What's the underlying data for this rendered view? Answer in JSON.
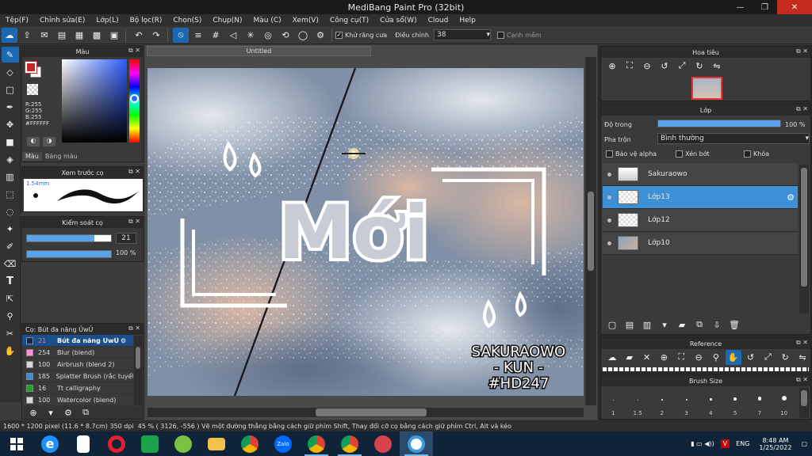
{
  "window": {
    "title": "MediBang Paint Pro (32bit)",
    "minimize_glyph": "—",
    "restore_glyph": "❐",
    "close_glyph": "✕"
  },
  "menu": [
    "Tệp(F)",
    "Chỉnh sửa(E)",
    "Lớp(L)",
    "Bộ lọc(R)",
    "Chọn(S)",
    "Chụp(N)",
    "Màu (C)",
    "Xem(V)",
    "Công cụ(T)",
    "Cửa sổ(W)",
    "Cloud",
    "Help"
  ],
  "toolbar": {
    "antialias_label": "Khử răng cưa",
    "antialias_checked": true,
    "adjust_label": "Điều chỉnh",
    "adjust_value": "38",
    "snap_label": "Cạnh mềm"
  },
  "color_panel": {
    "title": "Màu",
    "r": "R:255",
    "g": "G:255",
    "b": "B:255",
    "hex": "#FFFFFF",
    "tab_color": "Màu",
    "tab_palette": "Bảng màu",
    "fg_color": "#c62828",
    "bg_color": "#ffffff"
  },
  "brush_preview": {
    "title": "Xem trước cọ",
    "size": "1.54mm"
  },
  "brush_control": {
    "title": "Kiểm soát cọ",
    "size_value": "21",
    "opacity_value": "100 %",
    "size_fill": 0.8,
    "opacity_fill": 1.0
  },
  "brush_list": {
    "title": "Cọ: Bút đa năng ỦwỦ",
    "items": [
      {
        "size": "21",
        "name": "Bút đa năng ỦwỦ",
        "color": "#1a2a45",
        "selected": true
      },
      {
        "size": "254",
        "name": "Blur (blend)",
        "color": "#ff8fd6",
        "selected": false
      },
      {
        "size": "100",
        "name": "Airbrush (blend 2)",
        "color": "#d8d8d8",
        "selected": false
      },
      {
        "size": "185",
        "name": "Splatter Brush (rắc tuyết)",
        "color": "#3b8fd6",
        "selected": false
      },
      {
        "size": "16",
        "name": "Tt calligraphy",
        "color": "#22a022",
        "selected": false
      },
      {
        "size": "100",
        "name": "Watercolor (blend)",
        "color": "#d8d8d8",
        "selected": false
      }
    ]
  },
  "document": {
    "tab": "Untitled"
  },
  "artwork": {
    "main_text": "Mới",
    "credit_lines": [
      "SAKURAOWO",
      "- KUN -",
      "#HD247"
    ]
  },
  "navigator": {
    "title": "Hoa tiêu"
  },
  "layers": {
    "title": "Lớp",
    "opacity_label": "Độ trong",
    "opacity_value": "100 %",
    "opacity_fill": 1.0,
    "blend_label": "Pha trộn",
    "blend_value": "Bình thường",
    "protect_alpha": "Bảo vệ alpha",
    "clipping": "Xén bớt",
    "lock": "Khóa",
    "items": [
      {
        "name": "Sakuraowo",
        "selected": false
      },
      {
        "name": "Lớp13",
        "selected": true
      },
      {
        "name": "Lớp12",
        "selected": false
      },
      {
        "name": "Lớp10",
        "selected": false
      }
    ]
  },
  "reference": {
    "title": "Reference"
  },
  "brush_size": {
    "title": "Brush Size",
    "sizes": [
      "1",
      "1.5",
      "2",
      "3",
      "4",
      "5",
      "7",
      "10"
    ],
    "dots": [
      1,
      1,
      1.5,
      2,
      2.5,
      3.5,
      4.5,
      6
    ]
  },
  "status": {
    "dims": "1600 * 1200 pixel",
    "cm": "(11.6 * 8.7cm)",
    "dpi": "350 dpi",
    "zoom": "45 %",
    "coords": "( 3126, -556 )",
    "hint": "Vẽ một đường thẳng bằng cách giữ phím Shift, Thay đổi cỡ cọ bằng cách giữ phím Ctrl, Alt và kéo"
  },
  "taskbar": {
    "lang": "ENG",
    "time": "8:48 AM",
    "date": "1/25/2022",
    "zalo": "Zalo"
  }
}
